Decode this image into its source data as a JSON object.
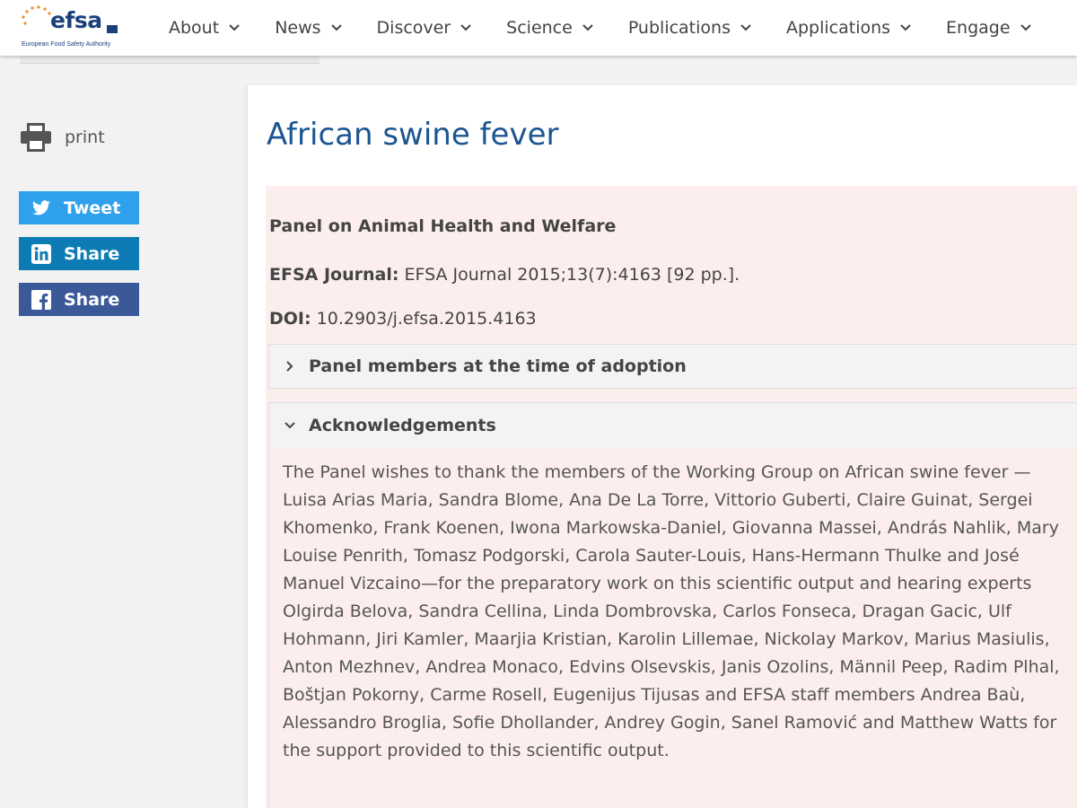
{
  "logo": {
    "word": "efsa",
    "subtitle": "European Food Safety Authority"
  },
  "nav": {
    "items": [
      {
        "label": "About"
      },
      {
        "label": "News"
      },
      {
        "label": "Discover"
      },
      {
        "label": "Science"
      },
      {
        "label": "Publications"
      },
      {
        "label": "Applications"
      },
      {
        "label": "Engage"
      }
    ]
  },
  "sidebar": {
    "print_label": "print",
    "tweet_label": "Tweet",
    "linkedin_label": "Share",
    "facebook_label": "Share"
  },
  "article": {
    "title": "African swine fever",
    "panel": "Panel on Animal Health and Welfare",
    "journal_label": "EFSA Journal:",
    "journal_value": "EFSA Journal 2015;13(7):4163 [92 pp.].",
    "doi_label": "DOI:",
    "doi_value": "10.2903/j.efsa.2015.4163",
    "accordion_panel_members": "Panel members at the time of adoption",
    "accordion_acknowledgements": "Acknowledgements",
    "acknowledgements_text": "The Panel wishes to thank the members of the Working Group on African swine fever —Luisa Arias Maria, Sandra Blome, Ana De La Torre, Vittorio Guberti, Claire Guinat, Sergei Khomenko, Frank Koenen, Iwona Markowska-Daniel, Giovanna Massei, András Nahlik, Mary Louise Penrith, Tomasz Podgorski, Carola Sauter-Louis, Hans-Hermann Thulke and José Manuel Vizcaino—for the preparatory work on this scientific output and hearing experts Olgirda Belova, Sandra Cellina, Linda Dombrovska, Carlos Fonseca, Dragan Gacic, Ulf Hohmann, Jiri Kamler, Maarjia Kristian, Karolin Lillemae, Nickolay Markov, Marius Masiulis, Anton Mezhnev, Andrea Monaco, Edvins Olsevskis, Janis Ozolins, Männil Peep, Radim Plhal, Boštjan Pokorny, Carme Rosell, Eugenijus Tijusas and EFSA staff members Andrea Baù, Alessandro Broglia, Sofie Dhollander, Andrey Gogin, Sanel Ramović and Matthew Watts for the support provided to this scientific output."
  },
  "colors": {
    "brand_blue": "#1c5591",
    "twitter": "#2fa1ec",
    "linkedin": "#0d7cb4",
    "facebook": "#3b5998",
    "info_box": "#fdeeee"
  },
  "icons": {
    "print": "printer-icon",
    "twitter": "twitter-bird-icon",
    "linkedin": "linkedin-icon",
    "facebook": "facebook-icon",
    "nav_dropdown": "chevron-down-icon",
    "accordion_collapsed": "chevron-right-icon",
    "accordion_expanded": "chevron-down-icon"
  }
}
